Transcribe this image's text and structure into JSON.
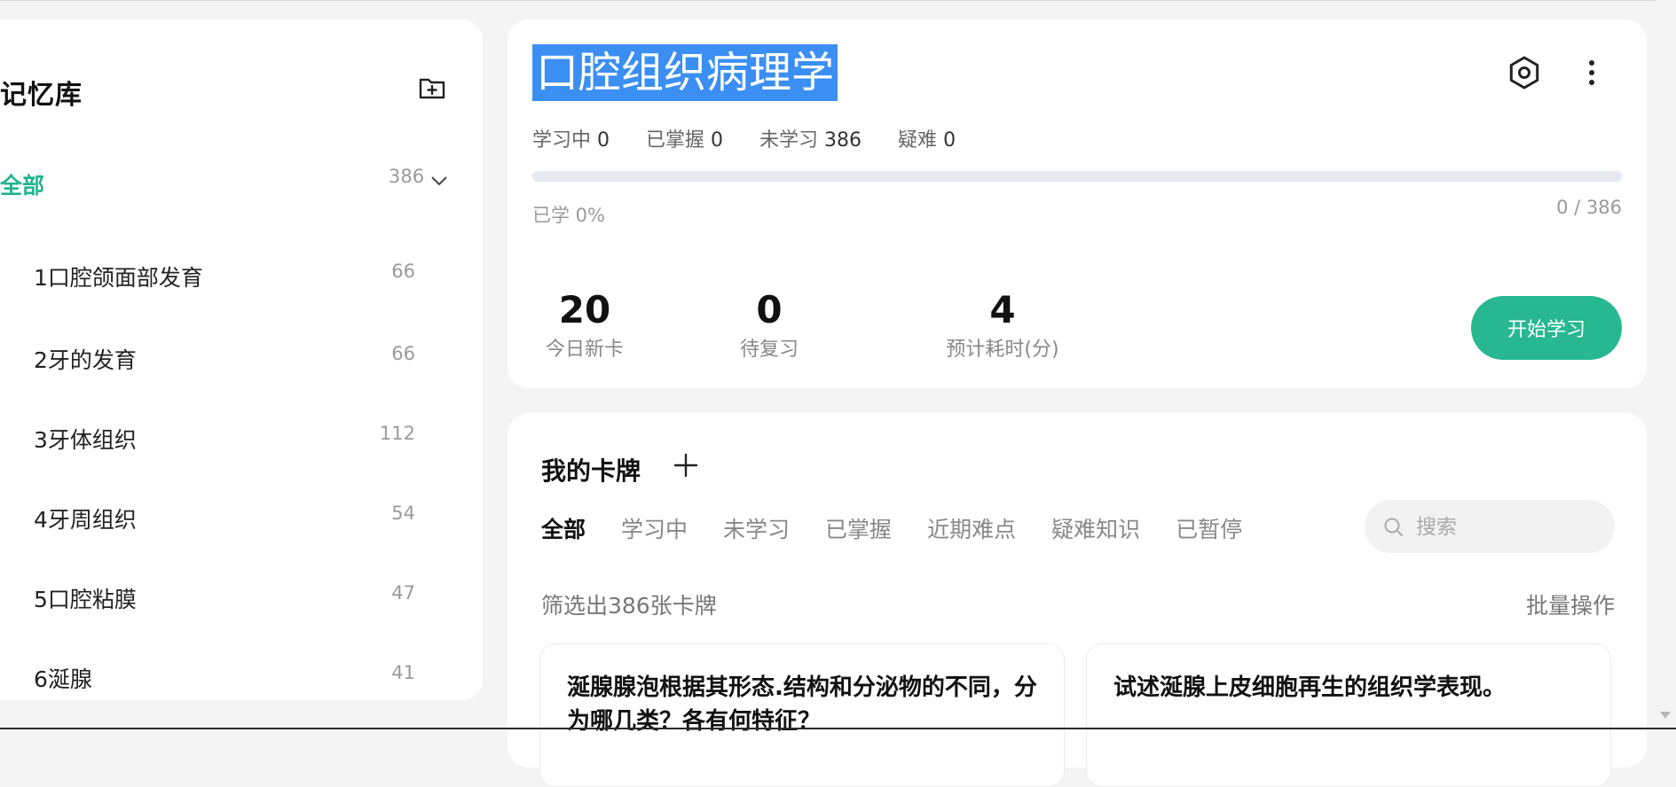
{
  "sidebar": {
    "title": "记忆库",
    "all": {
      "label": "全部",
      "count": "386"
    },
    "decks": [
      {
        "label": "1口腔颌面部发育",
        "count": "66"
      },
      {
        "label": "2牙的发育",
        "count": "66"
      },
      {
        "label": "3牙体组织",
        "count": "112"
      },
      {
        "label": "4牙周组织",
        "count": "54"
      },
      {
        "label": "5口腔粘膜",
        "count": "47"
      },
      {
        "label": "6涎腺",
        "count": "41"
      }
    ],
    "icons": {
      "add": "folder-plus-icon",
      "expand": "chevron-down-icon"
    }
  },
  "summary": {
    "title": "口腔组织病理学",
    "stats": [
      {
        "label": "学习中",
        "value": "0"
      },
      {
        "label": "已掌握",
        "value": "0"
      },
      {
        "label": "未学习",
        "value": "386"
      },
      {
        "label": "疑难",
        "value": "0"
      }
    ],
    "progress": {
      "label": "已学 0%",
      "fraction": 0,
      "ratio": "0 / 386"
    },
    "metrics": [
      {
        "value": "20",
        "label": "今日新卡"
      },
      {
        "value": "0",
        "label": "待复习"
      },
      {
        "value": "4",
        "label": "预计耗时(分)"
      }
    ],
    "start_label": "开始学习",
    "icons": {
      "settings": "settings-icon",
      "more": "more-vertical-icon"
    }
  },
  "cards": {
    "title": "我的卡牌",
    "tabs": [
      "全部",
      "学习中",
      "未学习",
      "已掌握",
      "近期难点",
      "疑难知识",
      "已暂停"
    ],
    "active_tab": 0,
    "search_placeholder": "搜索",
    "filter_text": "筛选出386张卡牌",
    "batch_label": "批量操作",
    "items": [
      {
        "text": "涎腺腺泡根据其形态.结构和分泌物的不同，分为哪几类？各有何特征？"
      },
      {
        "text": "试述涎腺上皮细胞再生的组织学表现。"
      }
    ]
  },
  "colors": {
    "accent": "#27b892",
    "selection": "#3b8ff3"
  }
}
